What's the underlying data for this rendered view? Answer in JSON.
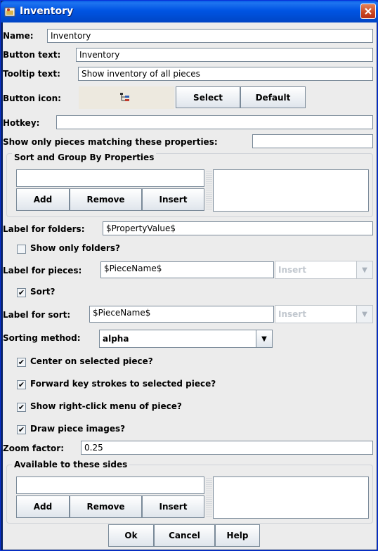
{
  "window": {
    "title": "Inventory"
  },
  "name": {
    "label": "Name:",
    "value": "Inventory"
  },
  "button_text": {
    "label": "Button text:",
    "value": "Inventory"
  },
  "tooltip_text": {
    "label": "Tooltip text:",
    "value": "Show inventory of all pieces"
  },
  "button_icon": {
    "label": "Button icon:",
    "select": "Select",
    "default": "Default"
  },
  "hotkey": {
    "label": "Hotkey:",
    "value": ""
  },
  "filter": {
    "label": "Show only pieces matching these properties:",
    "value": ""
  },
  "sort_group": {
    "title": "Sort and Group By Properties",
    "input_value": "",
    "add": "Add",
    "remove": "Remove",
    "insert": "Insert"
  },
  "folders_label": {
    "label": "Label for folders:",
    "value": "$PropertyValue$"
  },
  "show_only_folders": {
    "label": "Show only folders?",
    "checked": false
  },
  "pieces_label": {
    "label": "Label for pieces:",
    "value": "$PieceName$",
    "insert": "Insert"
  },
  "sort": {
    "label": "Sort?",
    "checked": true
  },
  "sort_label": {
    "label": "Label for sort:",
    "value": "$PieceName$",
    "insert": "Insert"
  },
  "sorting_method": {
    "label": "Sorting method:",
    "value": "alpha"
  },
  "options": [
    {
      "label": "Center on selected piece?",
      "checked": true
    },
    {
      "label": "Forward key strokes to selected piece?",
      "checked": true
    },
    {
      "label": "Show right-click menu of piece?",
      "checked": true
    },
    {
      "label": "Draw piece images?",
      "checked": true
    }
  ],
  "zoom": {
    "label": "Zoom factor:",
    "value": "0.25"
  },
  "sides": {
    "title": "Available to these sides",
    "input_value": "",
    "add": "Add",
    "remove": "Remove",
    "insert": "Insert"
  },
  "footer": {
    "ok": "Ok",
    "cancel": "Cancel",
    "help": "Help"
  }
}
